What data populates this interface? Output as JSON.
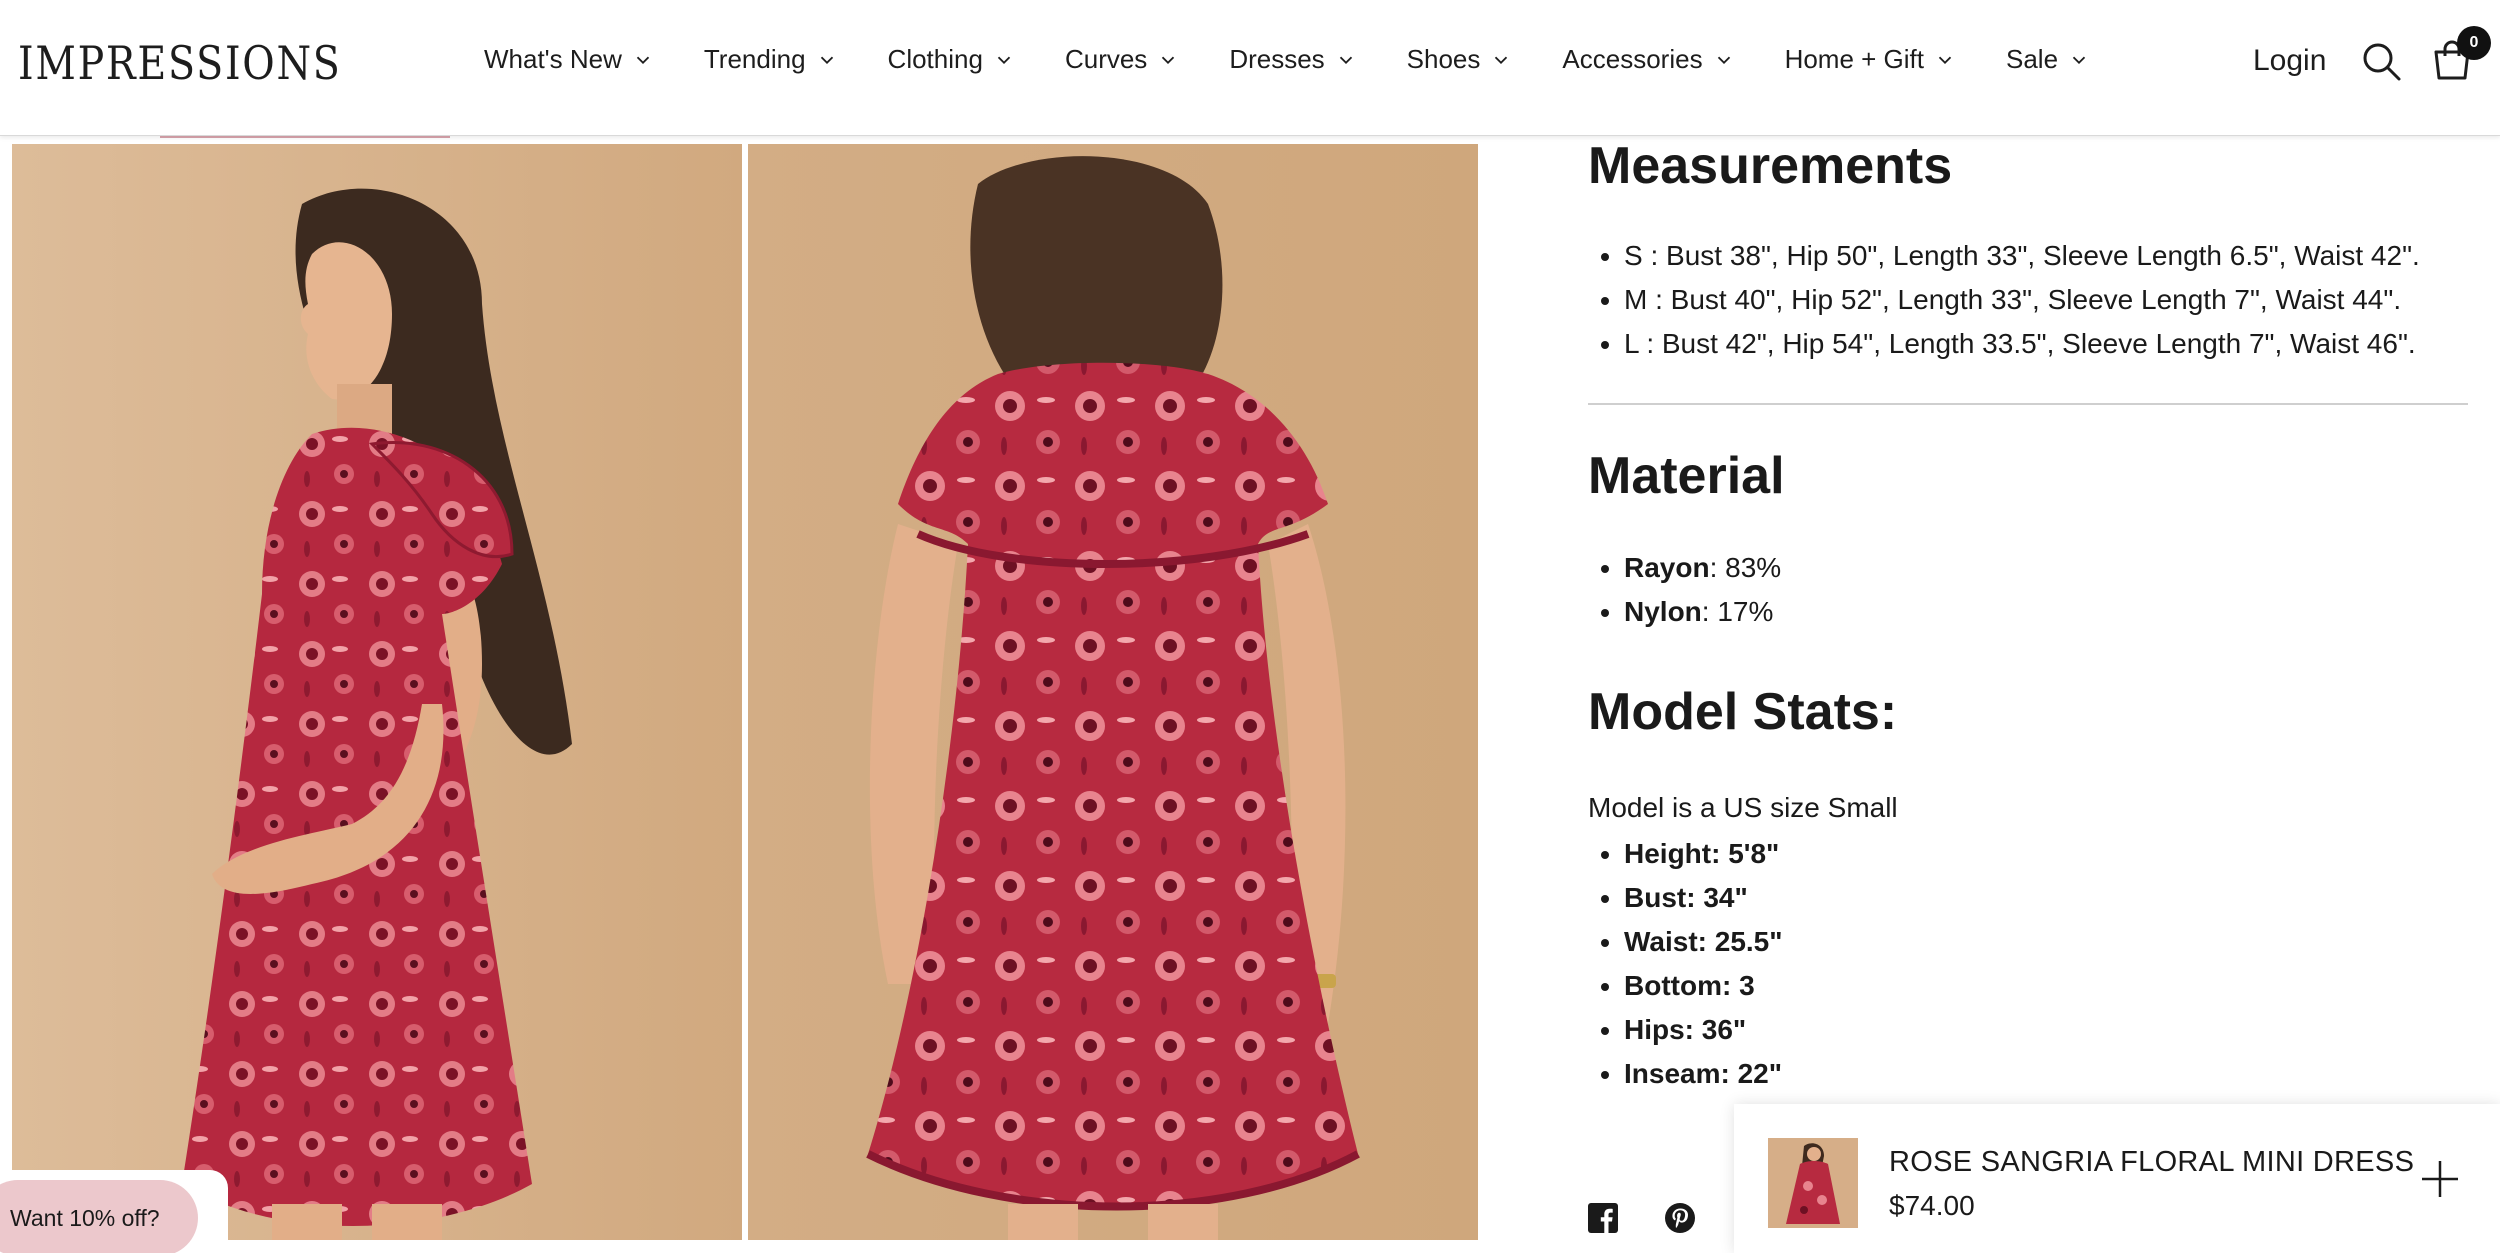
{
  "header": {
    "logo": "IMPRESSIONS",
    "nav": [
      "What's New",
      "Trending",
      "Clothing",
      "Curves",
      "Dresses",
      "Shoes",
      "Accessories",
      "Home + Gift",
      "Sale"
    ],
    "login": "Login",
    "cart_count": "0"
  },
  "measurements": {
    "title": "Measurements",
    "items": [
      "S : Bust 38\", Hip 50\", Length 33\", Sleeve Length 6.5\", Waist 42\".",
      "M : Bust 40\", Hip 52\", Length 33\", Sleeve Length 7\", Waist 44\".",
      "L : Bust 42\", Hip 54\", Length 33.5\", Sleeve Length 7\", Waist 46\"."
    ]
  },
  "material": {
    "title": "Material",
    "items": [
      {
        "name": "Rayon",
        "value": ": 83%"
      },
      {
        "name": "Nylon",
        "value": ": 17%"
      }
    ]
  },
  "model_stats": {
    "title": "Model Stats:",
    "intro": "Model is a US size Small",
    "items": [
      "Height: 5'8\"",
      "Bust: 34\"",
      "Waist: 25.5\"",
      "Bottom: 3",
      "Hips: 36\"",
      "Inseam: 22\""
    ]
  },
  "sticky_bar": {
    "title": "ROSE SANGRIA FLORAL MINI DRESS",
    "price": "$74.00"
  },
  "promo": {
    "label": "Want 10% off?"
  },
  "colors": {
    "backdrop": "#d8b48e",
    "dress": "#b5283f",
    "promo": "#ecc8cc"
  }
}
